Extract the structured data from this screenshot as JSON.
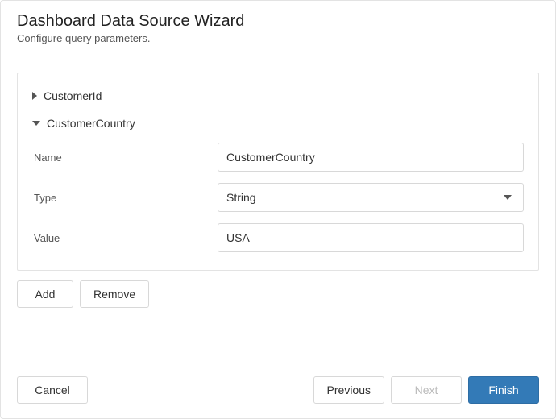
{
  "header": {
    "title": "Dashboard Data Source Wizard",
    "subtitle": "Configure query parameters."
  },
  "parameters": {
    "collapsed": {
      "label": "CustomerId"
    },
    "expanded": {
      "label": "CustomerCountry",
      "fields": {
        "name_label": "Name",
        "name_value": "CustomerCountry",
        "type_label": "Type",
        "type_value": "String",
        "value_label": "Value",
        "value_value": "USA"
      }
    }
  },
  "actions": {
    "add": "Add",
    "remove": "Remove"
  },
  "footer": {
    "cancel": "Cancel",
    "previous": "Previous",
    "next": "Next",
    "finish": "Finish"
  }
}
